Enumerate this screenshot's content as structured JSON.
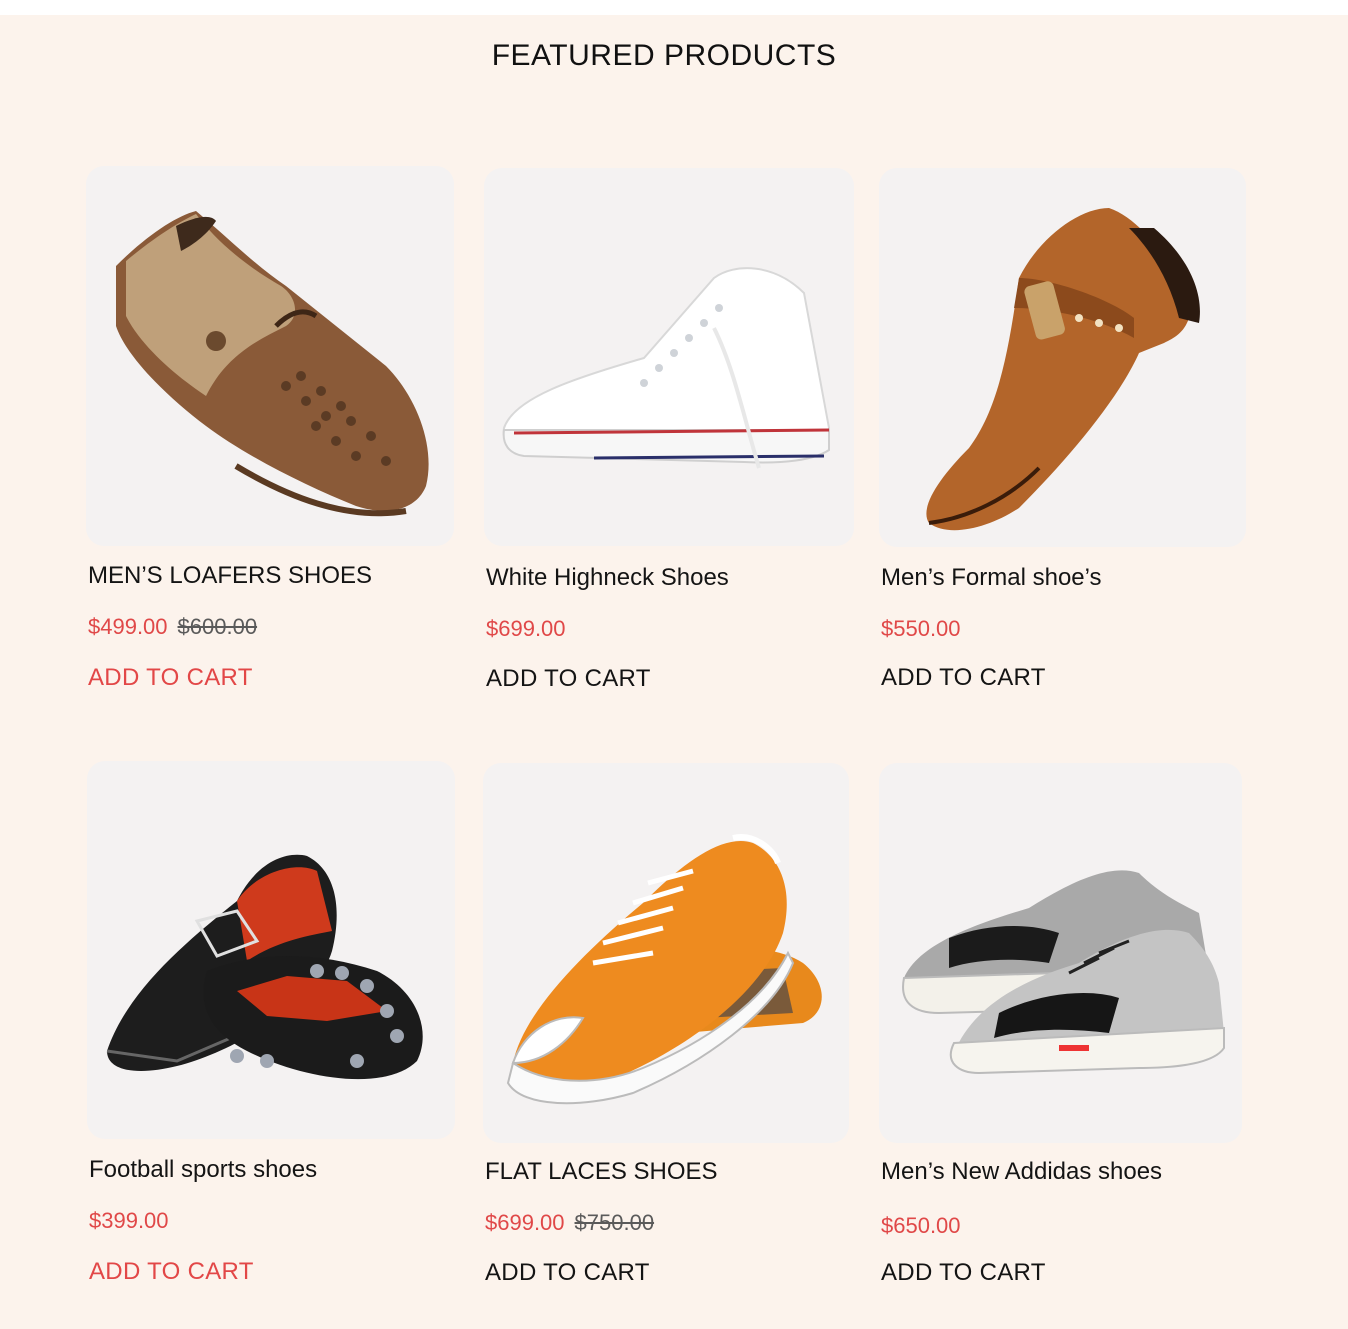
{
  "section": {
    "title": "FEATURED PRODUCTS"
  },
  "products": [
    {
      "name": "MEN’S LOAFERS SHOES",
      "price": "$499.00",
      "old_price": "$600.00",
      "cta": "ADD  TO CART",
      "cta_color": "#e24747",
      "image": "brown-loafer-shoe"
    },
    {
      "name": "White Highneck  Shoes",
      "price": "$699.00",
      "old_price": "",
      "cta": "ADD  TO CART",
      "cta_color": "#141414",
      "image": "white-high-top-sneaker"
    },
    {
      "name": "Men’s Formal shoe’s",
      "price": "$550.00",
      "old_price": "",
      "cta": "ADD  TO CART",
      "cta_color": "#141414",
      "image": "tan-formal-shoe"
    },
    {
      "name": "Football sports  shoes",
      "price": "$399.00",
      "old_price": "",
      "cta": "ADD  TO CART",
      "cta_color": "#e24747",
      "image": "football-boots"
    },
    {
      "name": "FLAT LACES SHOES",
      "price": "$699.00",
      "old_price": "$750.00",
      "cta": "ADD  TO CART",
      "cta_color": "#141414",
      "image": "orange-canvas-sneakers"
    },
    {
      "name": "Men’s  New Addidas shoes",
      "price": "$650.00",
      "old_price": "",
      "cta": "ADD  TO CART",
      "cta_color": "#141414",
      "image": "black-grey-sneakers"
    }
  ],
  "colors": {
    "background": "#fcf3ec",
    "card": "#f4f2f2",
    "accent": "#e24747"
  }
}
